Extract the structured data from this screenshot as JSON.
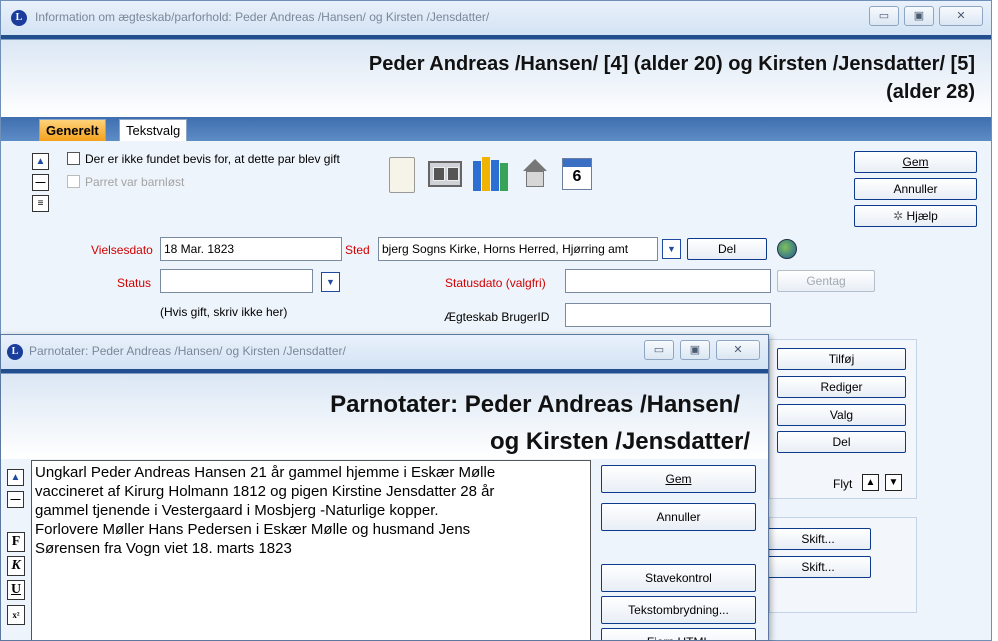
{
  "main": {
    "title": "Information om ægteskab/parforhold: Peder Andreas /Hansen/ og Kirsten /Jensdatter/",
    "heading_line1": "Peder Andreas /Hansen/ [4] (alder 20) og Kirsten /Jensdatter/ [5]",
    "heading_line2": "(alder 28)",
    "window_buttons": {
      "minimize": "▭",
      "maximize": "▣",
      "close": "✕"
    },
    "tabs": [
      {
        "label": "Generelt"
      },
      {
        "label": "Tekstvalg"
      }
    ],
    "checkboxes": {
      "no_proof": "Der er ikke fundet bevis for, at dette par blev gift",
      "childless": "Parret var barnløst"
    },
    "calendar_day": "6",
    "buttons": {
      "gem": "Gem",
      "annuller": "Annuller",
      "hjaelp": "Hjælp",
      "del": "Del",
      "gentag": "Gentag",
      "tilfoj": "Tilføj",
      "rediger": "Rediger",
      "valg": "Valg",
      "del2": "Del",
      "skift1": "Skift...",
      "skift2": "Skift...",
      "flyt": "Flyt"
    },
    "fields": {
      "vielsesdato_label": "Vielsesdato",
      "vielsesdato_value": "18 Mar. 1823",
      "sted_label": "Sted",
      "sted_value": "bjerg Sogns Kirke, Horns Herred, Hjørring amt",
      "status_label": "Status",
      "status_value": "",
      "status_hint": "(Hvis gift, skriv ikke her)",
      "statusdato_label": "Statusdato (valgfri)",
      "statusdato_value": "",
      "brugerid_label": "Ægteskab BrugerID",
      "brugerid_value": ""
    }
  },
  "notes": {
    "title": "Parnotater: Peder Andreas /Hansen/ og Kirsten /Jensdatter/",
    "heading_line1": "Parnotater: Peder Andreas /Hansen/",
    "heading_line2": "og Kirsten /Jensdatter/",
    "text_lines": [
      "Ungkarl Peder Andreas Hansen 21 år gammel hjemme i Eskær Mølle",
      "vaccineret af Kirurg Holmann 1812 og pigen Kirstine Jensdatter 28 år",
      "gammel tjenende i Vestergaard i Mosbjerg -Naturlige kopper.",
      "Forlovere Møller Hans Pedersen i Eskær Mølle og husmand Jens",
      "Sørensen fra Vogn viet 18. marts 1823"
    ],
    "buttons": {
      "gem": "Gem",
      "annuller": "Annuller",
      "stavekontrol": "Stavekontrol",
      "tekstombrydning": "Tekstombrydning...",
      "fjern_html": "Fjern HTML"
    },
    "format": {
      "bold": "F",
      "italic": "K",
      "underline": "U",
      "superscript": "x²"
    }
  },
  "colors": {
    "accent": "#0e3a8c",
    "required_label": "#d10000",
    "banner_stripe": "#224e8e"
  }
}
